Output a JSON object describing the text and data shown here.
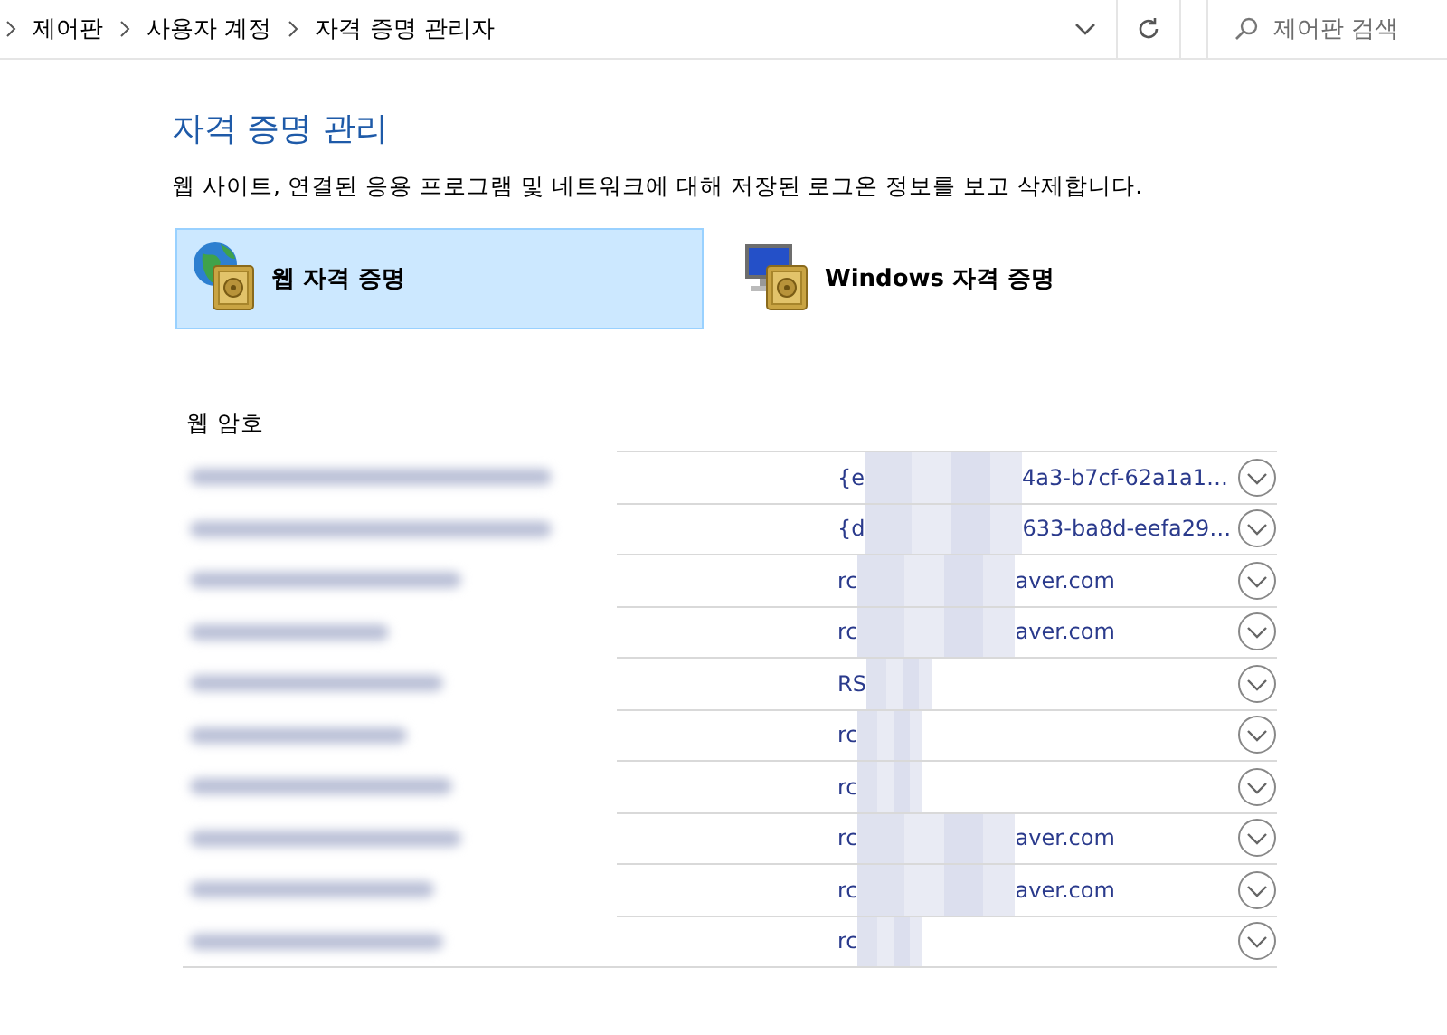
{
  "address_bar": {
    "breadcrumbs": [
      "제어판",
      "사용자 계정",
      "자격 증명 관리자"
    ],
    "search": {
      "placeholder": "제어판 검색"
    }
  },
  "page": {
    "title": "자격 증명 관리",
    "description": "웹 사이트, 연결된 응용 프로그램 및 네트워크에 대해 저장된 로그온 정보를 보고 삭제합니다."
  },
  "tabs": [
    {
      "label": "웹 자격 증명",
      "kind": "web",
      "selected": true
    },
    {
      "label": "Windows 자격 증명",
      "kind": "windows",
      "selected": false
    }
  ],
  "section": {
    "title": "웹 암호"
  },
  "credentials": [
    {
      "value_start": "{e",
      "value_end": "4a3-b7cf-62a1a1…"
    },
    {
      "value_start": "{d",
      "value_end": "633-ba8d-eefa29…"
    },
    {
      "value_start": "rc",
      "value_end": "aver.com"
    },
    {
      "value_start": "rc",
      "value_end": "aver.com"
    },
    {
      "value_start": "RS"
    },
    {
      "value_start": "rc"
    },
    {
      "value_start": "rc"
    },
    {
      "value_start": "rc",
      "value_end": "aver.com"
    },
    {
      "value_start": "rc",
      "value_end": "aver.com"
    },
    {
      "value_start": "rc"
    }
  ]
}
